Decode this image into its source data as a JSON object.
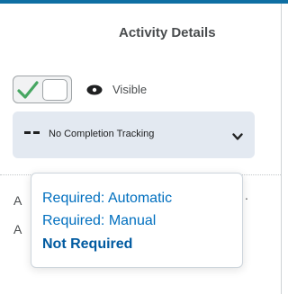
{
  "panel": {
    "title": "Activity Details"
  },
  "visibility": {
    "label": "Visible",
    "toggle_on": true,
    "check_icon": "checkmark-icon",
    "eye_icon": "eye-icon"
  },
  "completion": {
    "selected_label": "No Completion Tracking",
    "prefix_icon": "dash-icon",
    "chevron_icon": "chevron-down-icon"
  },
  "background": {
    "row1_initial": "A",
    "row2_initial": "A",
    "row1_trailing": "."
  },
  "dropdown": {
    "options": [
      {
        "label": "Required: Automatic"
      },
      {
        "label": "Required: Manual"
      },
      {
        "label": "Not Required"
      }
    ]
  },
  "colors": {
    "accent": "#006fbf",
    "check_green": "#46a661",
    "select_bg": "#e3e9f1",
    "top_border": "#0f6fa3"
  }
}
